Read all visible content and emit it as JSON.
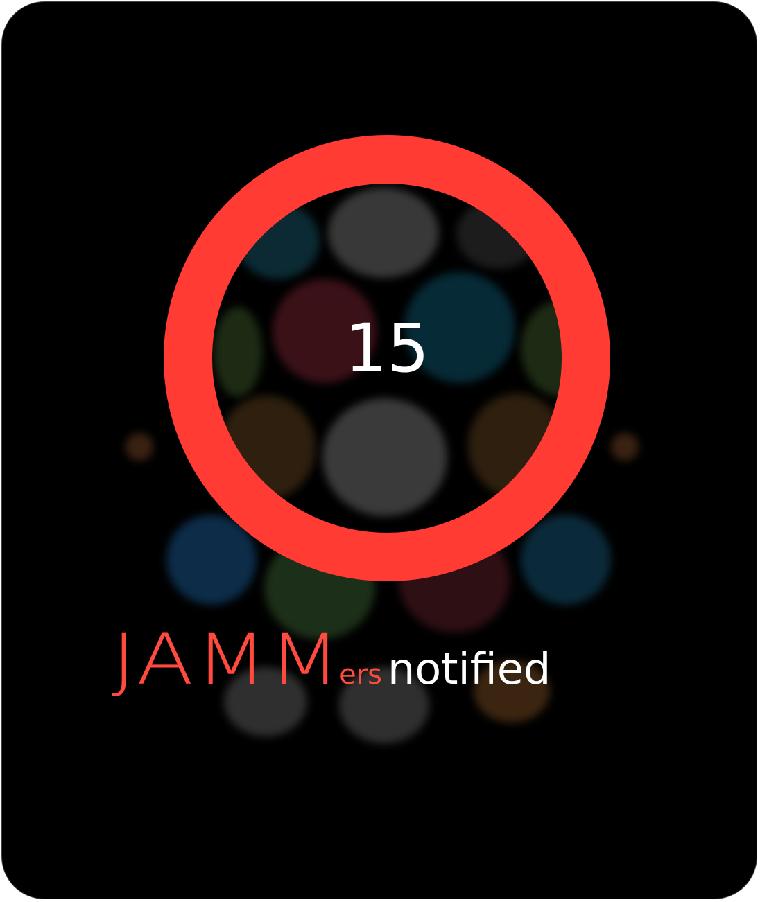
{
  "notification": {
    "count": "15",
    "brand_text": "JAMM",
    "brand_suffix": "ers",
    "tail_text": "notified"
  },
  "colors": {
    "ring": "#ff3b34",
    "brand": "#ff4a40",
    "background": "#000000",
    "count_text": "#ffffff"
  }
}
